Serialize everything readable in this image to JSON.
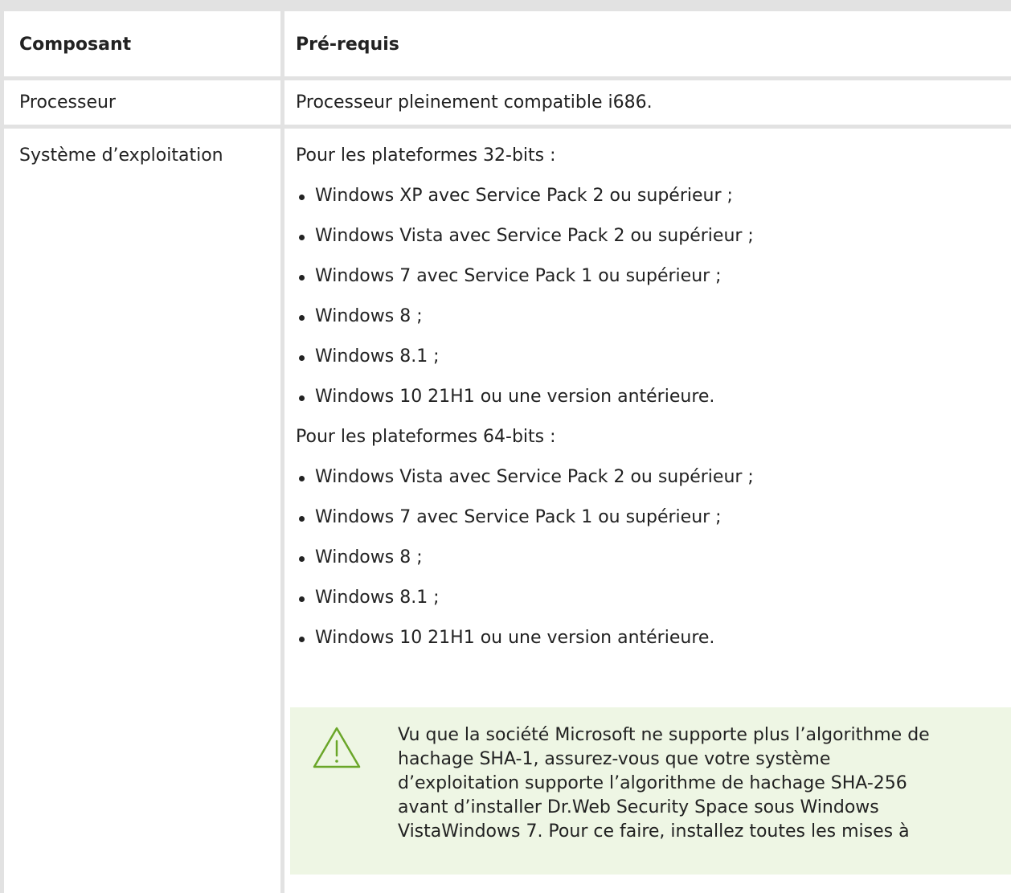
{
  "table": {
    "headers": [
      "Composant",
      "Pré-requis"
    ],
    "rows": {
      "processor": {
        "component": "Processeur",
        "requirement": "Processeur pleinement compatible i686."
      },
      "os": {
        "component": "Système d’exploitation",
        "intro_32": "Pour les plateformes 32-bits :",
        "list_32": [
          "Windows XP avec Service Pack 2 ou supérieur ;",
          "Windows Vista avec Service Pack 2 ou supérieur ;",
          "Windows 7 avec Service Pack 1 ou supérieur ;",
          "Windows 8 ;",
          "Windows 8.1 ;",
          "Windows 10 21H1 ou une version antérieure."
        ],
        "intro_64": "Pour les plateformes 64-bits :",
        "list_64": [
          "Windows Vista avec Service Pack 2 ou supérieur ;",
          "Windows 7 avec Service Pack 1 ou supérieur ;",
          "Windows 8 ;",
          "Windows 8.1 ;",
          "Windows 10 21H1 ou une version antérieure."
        ],
        "warning": {
          "icon": "warning-triangle-icon",
          "lines": [
            "Vu que la société Microsoft ne supporte plus l’algorithme de",
            "hachage SHA-1, assurez-vous que votre système",
            "d’exploitation supporte l’algorithme de hachage SHA-256",
            "avant d’installer Dr.Web Security Space sous Windows",
            "VistaWindows 7. Pour ce faire, installez toutes les mises à"
          ]
        }
      }
    }
  },
  "colors": {
    "border": "#e2e2e2",
    "text": "#222222",
    "warning_bg": "#eef6e4",
    "warning_icon": "#6aa629"
  }
}
